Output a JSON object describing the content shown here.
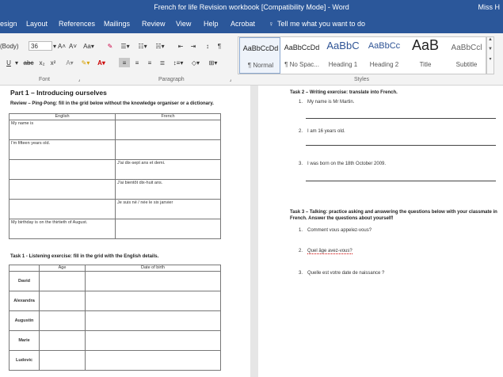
{
  "window": {
    "title": "French for life Revision workbook [Compatibility Mode] - Word",
    "user": "Miss H"
  },
  "tabs": [
    "esign",
    "Layout",
    "References",
    "Mailings",
    "Review",
    "View",
    "Help",
    "Acrobat",
    "Tell me what you want to do"
  ],
  "ribbon": {
    "font_name": "(Body)",
    "font_size": "36",
    "groups": {
      "font": "Font",
      "paragraph": "Paragraph",
      "styles": "Styles"
    },
    "styles": [
      {
        "sample": "AaBbCcDd",
        "name": "¶ Normal"
      },
      {
        "sample": "AaBbCcDd",
        "name": "¶ No Spac..."
      },
      {
        "sample": "AaBbC",
        "name": "Heading 1"
      },
      {
        "sample": "AaBbCc",
        "name": "Heading 2"
      },
      {
        "sample": "AaB",
        "name": "Title"
      },
      {
        "sample": "AaBbCcl",
        "name": "Subtitle"
      }
    ]
  },
  "page1": {
    "heading": "Part 1 – Introducing ourselves",
    "review_instr": "Review – Ping-Pong: fill in the grid below without the knowledge organiser or a dictionary.",
    "col_english": "English",
    "col_french": "French",
    "rows": [
      {
        "en": "My name is",
        "fr": ""
      },
      {
        "en": "I'm fifteen years old.",
        "fr": ""
      },
      {
        "en": "",
        "fr": "J'ai dix-sept ans et demi."
      },
      {
        "en": "",
        "fr": "J'ai bientôt dix-huit ans."
      },
      {
        "en": "",
        "fr": "Je suis né / née le six janvier"
      },
      {
        "en": "My birthday is on the thirtieth of August.",
        "fr": ""
      }
    ],
    "task1": "Task 1 - Listening exercise: fill in the grid with the English details.",
    "col_age": "Age",
    "col_dob": "Date of birth",
    "names": [
      "David",
      "Alexandra",
      "Augustin",
      "Marie",
      "Ludovic"
    ]
  },
  "page2": {
    "task2": "Task 2 – Writing exercise: translate into French.",
    "items": [
      "My name is Mr Martin.",
      "I am 16 years old.",
      "I was born on the 18th October 2009."
    ],
    "task3_line1": "Task 3 – Talking: practice asking and answering the questions below with your classmate in",
    "task3_line2": "French. Answer the questions about yourself!",
    "questions": [
      "Comment vous appelez-vous?",
      "Quel âge avez-vous?",
      "Quelle est votre date de naissance ?"
    ]
  }
}
